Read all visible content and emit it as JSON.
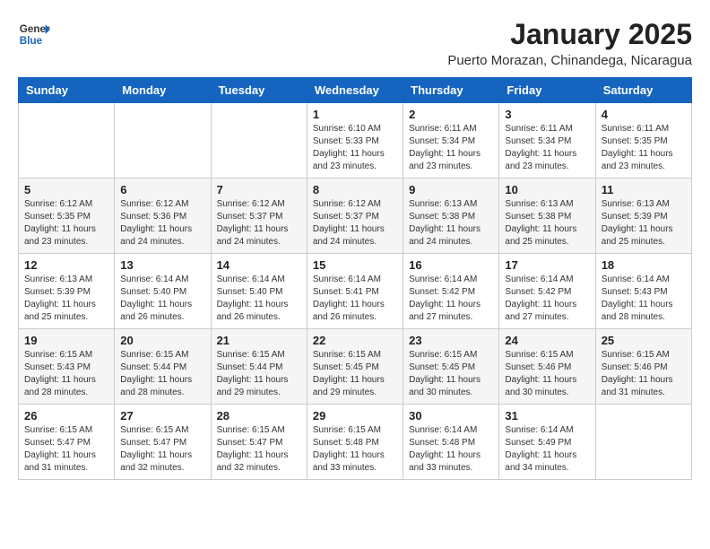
{
  "header": {
    "logo_line1": "General",
    "logo_line2": "Blue",
    "month": "January 2025",
    "location": "Puerto Morazan, Chinandega, Nicaragua"
  },
  "weekdays": [
    "Sunday",
    "Monday",
    "Tuesday",
    "Wednesday",
    "Thursday",
    "Friday",
    "Saturday"
  ],
  "weeks": [
    [
      {
        "day": "",
        "info": ""
      },
      {
        "day": "",
        "info": ""
      },
      {
        "day": "",
        "info": ""
      },
      {
        "day": "1",
        "info": "Sunrise: 6:10 AM\nSunset: 5:33 PM\nDaylight: 11 hours\nand 23 minutes."
      },
      {
        "day": "2",
        "info": "Sunrise: 6:11 AM\nSunset: 5:34 PM\nDaylight: 11 hours\nand 23 minutes."
      },
      {
        "day": "3",
        "info": "Sunrise: 6:11 AM\nSunset: 5:34 PM\nDaylight: 11 hours\nand 23 minutes."
      },
      {
        "day": "4",
        "info": "Sunrise: 6:11 AM\nSunset: 5:35 PM\nDaylight: 11 hours\nand 23 minutes."
      }
    ],
    [
      {
        "day": "5",
        "info": "Sunrise: 6:12 AM\nSunset: 5:35 PM\nDaylight: 11 hours\nand 23 minutes."
      },
      {
        "day": "6",
        "info": "Sunrise: 6:12 AM\nSunset: 5:36 PM\nDaylight: 11 hours\nand 24 minutes."
      },
      {
        "day": "7",
        "info": "Sunrise: 6:12 AM\nSunset: 5:37 PM\nDaylight: 11 hours\nand 24 minutes."
      },
      {
        "day": "8",
        "info": "Sunrise: 6:12 AM\nSunset: 5:37 PM\nDaylight: 11 hours\nand 24 minutes."
      },
      {
        "day": "9",
        "info": "Sunrise: 6:13 AM\nSunset: 5:38 PM\nDaylight: 11 hours\nand 24 minutes."
      },
      {
        "day": "10",
        "info": "Sunrise: 6:13 AM\nSunset: 5:38 PM\nDaylight: 11 hours\nand 25 minutes."
      },
      {
        "day": "11",
        "info": "Sunrise: 6:13 AM\nSunset: 5:39 PM\nDaylight: 11 hours\nand 25 minutes."
      }
    ],
    [
      {
        "day": "12",
        "info": "Sunrise: 6:13 AM\nSunset: 5:39 PM\nDaylight: 11 hours\nand 25 minutes."
      },
      {
        "day": "13",
        "info": "Sunrise: 6:14 AM\nSunset: 5:40 PM\nDaylight: 11 hours\nand 26 minutes."
      },
      {
        "day": "14",
        "info": "Sunrise: 6:14 AM\nSunset: 5:40 PM\nDaylight: 11 hours\nand 26 minutes."
      },
      {
        "day": "15",
        "info": "Sunrise: 6:14 AM\nSunset: 5:41 PM\nDaylight: 11 hours\nand 26 minutes."
      },
      {
        "day": "16",
        "info": "Sunrise: 6:14 AM\nSunset: 5:42 PM\nDaylight: 11 hours\nand 27 minutes."
      },
      {
        "day": "17",
        "info": "Sunrise: 6:14 AM\nSunset: 5:42 PM\nDaylight: 11 hours\nand 27 minutes."
      },
      {
        "day": "18",
        "info": "Sunrise: 6:14 AM\nSunset: 5:43 PM\nDaylight: 11 hours\nand 28 minutes."
      }
    ],
    [
      {
        "day": "19",
        "info": "Sunrise: 6:15 AM\nSunset: 5:43 PM\nDaylight: 11 hours\nand 28 minutes."
      },
      {
        "day": "20",
        "info": "Sunrise: 6:15 AM\nSunset: 5:44 PM\nDaylight: 11 hours\nand 28 minutes."
      },
      {
        "day": "21",
        "info": "Sunrise: 6:15 AM\nSunset: 5:44 PM\nDaylight: 11 hours\nand 29 minutes."
      },
      {
        "day": "22",
        "info": "Sunrise: 6:15 AM\nSunset: 5:45 PM\nDaylight: 11 hours\nand 29 minutes."
      },
      {
        "day": "23",
        "info": "Sunrise: 6:15 AM\nSunset: 5:45 PM\nDaylight: 11 hours\nand 30 minutes."
      },
      {
        "day": "24",
        "info": "Sunrise: 6:15 AM\nSunset: 5:46 PM\nDaylight: 11 hours\nand 30 minutes."
      },
      {
        "day": "25",
        "info": "Sunrise: 6:15 AM\nSunset: 5:46 PM\nDaylight: 11 hours\nand 31 minutes."
      }
    ],
    [
      {
        "day": "26",
        "info": "Sunrise: 6:15 AM\nSunset: 5:47 PM\nDaylight: 11 hours\nand 31 minutes."
      },
      {
        "day": "27",
        "info": "Sunrise: 6:15 AM\nSunset: 5:47 PM\nDaylight: 11 hours\nand 32 minutes."
      },
      {
        "day": "28",
        "info": "Sunrise: 6:15 AM\nSunset: 5:47 PM\nDaylight: 11 hours\nand 32 minutes."
      },
      {
        "day": "29",
        "info": "Sunrise: 6:15 AM\nSunset: 5:48 PM\nDaylight: 11 hours\nand 33 minutes."
      },
      {
        "day": "30",
        "info": "Sunrise: 6:14 AM\nSunset: 5:48 PM\nDaylight: 11 hours\nand 33 minutes."
      },
      {
        "day": "31",
        "info": "Sunrise: 6:14 AM\nSunset: 5:49 PM\nDaylight: 11 hours\nand 34 minutes."
      },
      {
        "day": "",
        "info": ""
      }
    ]
  ]
}
